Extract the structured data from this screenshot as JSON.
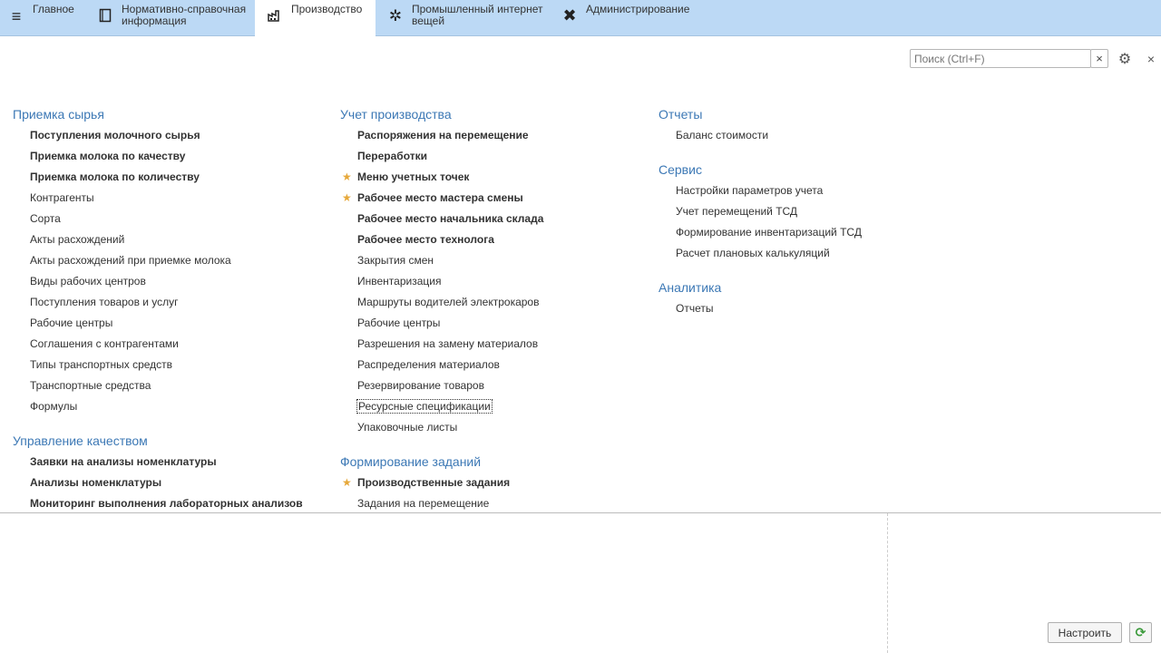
{
  "nav": {
    "tabs": [
      {
        "label": "Главное",
        "icon": "menu-icon"
      },
      {
        "label": "Нормативно-справочная\nинформация",
        "icon": "book-icon"
      },
      {
        "label": "Производство",
        "icon": "factory-icon",
        "active": true
      },
      {
        "label": "Промышленный интернет\nвещей",
        "icon": "iot-icon"
      },
      {
        "label": "Администрирование",
        "icon": "tools-icon"
      }
    ]
  },
  "search": {
    "placeholder": "Поиск (Ctrl+F)",
    "clear": "×"
  },
  "close": "×",
  "gear": "⚙",
  "columns": {
    "col1": [
      {
        "title": "Приемка сырья",
        "items": [
          {
            "label": "Поступления молочного сырья",
            "bold": true
          },
          {
            "label": "Приемка молока по качеству",
            "bold": true
          },
          {
            "label": "Приемка молока по количеству",
            "bold": true
          },
          {
            "label": "Контрагенты"
          },
          {
            "label": "Сорта"
          },
          {
            "label": "Акты расхождений"
          },
          {
            "label": "Акты расхождений при приемке молока"
          },
          {
            "label": "Виды рабочих центров"
          },
          {
            "label": "Поступления товаров и услуг"
          },
          {
            "label": "Рабочие центры"
          },
          {
            "label": "Соглашения с контрагентами"
          },
          {
            "label": "Типы транспортных средств"
          },
          {
            "label": "Транспортные средства"
          },
          {
            "label": "Формулы"
          }
        ]
      },
      {
        "title": "Управление качеством",
        "items": [
          {
            "label": "Заявки на анализы номенклатуры",
            "bold": true
          },
          {
            "label": "Анализы номенклатуры",
            "bold": true
          },
          {
            "label": "Мониторинг выполнения лабораторных анализов",
            "bold": true
          }
        ]
      }
    ],
    "col2": [
      {
        "title": "Учет производства",
        "items": [
          {
            "label": "Распоряжения на перемещение",
            "bold": true
          },
          {
            "label": "Переработки",
            "bold": true
          },
          {
            "label": "Меню учетных точек",
            "bold": true,
            "star": true
          },
          {
            "label": "Рабочее место мастера смены",
            "bold": true,
            "star": true
          },
          {
            "label": "Рабочее место начальника склада",
            "bold": true
          },
          {
            "label": "Рабочее место технолога",
            "bold": true
          },
          {
            "label": "Закрытия смен"
          },
          {
            "label": "Инвентаризация"
          },
          {
            "label": "Маршруты водителей электрокаров"
          },
          {
            "label": "Рабочие центры"
          },
          {
            "label": "Разрешения на замену материалов"
          },
          {
            "label": "Распределения материалов"
          },
          {
            "label": "Резервирование товаров"
          },
          {
            "label": "Ресурсные спецификации",
            "focused": true
          },
          {
            "label": "Упаковочные листы"
          }
        ]
      },
      {
        "title": "Формирование заданий",
        "items": [
          {
            "label": "Производственные задания",
            "bold": true,
            "star": true
          },
          {
            "label": "Задания на перемещение"
          }
        ]
      }
    ],
    "col3": [
      {
        "title": "Отчеты",
        "items": [
          {
            "label": "Баланс стоимости"
          }
        ]
      },
      {
        "title": "Сервис",
        "items": [
          {
            "label": "Настройки параметров учета"
          },
          {
            "label": "Учет перемещений ТСД"
          },
          {
            "label": "Формирование инвентаризаций ТСД"
          },
          {
            "label": "Расчет плановых калькуляций"
          }
        ]
      },
      {
        "title": "Аналитика",
        "items": [
          {
            "label": "Отчеты"
          }
        ]
      }
    ]
  },
  "buttons": {
    "setup": "Настроить",
    "refresh": "⟳"
  },
  "colors": {
    "topbar": "#bcd9f5",
    "groupTitle": "#3c78b5",
    "star": "#e6a83a"
  }
}
